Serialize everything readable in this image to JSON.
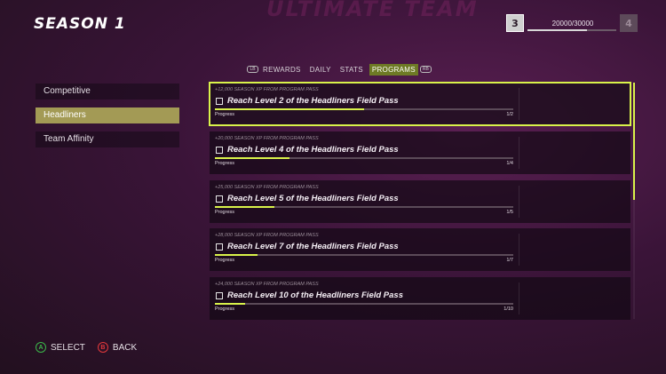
{
  "header": {
    "title": "SEASON 1",
    "watermark": "ULTIMATE TEAM",
    "level_current": "3",
    "level_next": "4",
    "xp_text": "20000/30000",
    "xp_progress": 0.6667
  },
  "tabs": {
    "lb": "LB",
    "rb": "RB",
    "items": [
      {
        "label": "REWARDS",
        "active": false
      },
      {
        "label": "DAILY",
        "active": false
      },
      {
        "label": "STATS",
        "active": false
      },
      {
        "label": "PROGRAMS",
        "active": true
      }
    ]
  },
  "sidebar": {
    "items": [
      {
        "label": "Competitive",
        "active": false
      },
      {
        "label": "Headliners",
        "active": true
      },
      {
        "label": "Team Affinity",
        "active": false
      }
    ]
  },
  "programs": [
    {
      "reward": "+12,000 SEASON XP FROM PROGRAM PASS",
      "title": "Reach Level 2 of the Headliners Field Pass",
      "progress_label": "Progress",
      "count": "1/2",
      "progress": 0.5
    },
    {
      "reward": "+20,000 SEASON XP FROM PROGRAM PASS",
      "title": "Reach Level 4 of the Headliners Field Pass",
      "progress_label": "Progress",
      "count": "1/4",
      "progress": 0.25
    },
    {
      "reward": "+25,000 SEASON XP FROM PROGRAM PASS",
      "title": "Reach Level 5 of the Headliners Field Pass",
      "progress_label": "Progress",
      "count": "1/5",
      "progress": 0.2
    },
    {
      "reward": "+28,000 SEASON XP FROM PROGRAM PASS",
      "title": "Reach Level 7 of the Headliners Field Pass",
      "progress_label": "Progress",
      "count": "1/7",
      "progress": 0.143
    },
    {
      "reward": "+24,000 SEASON XP FROM PROGRAM PASS",
      "title": "Reach Level 10 of the Headliners Field Pass",
      "progress_label": "Progress",
      "count": "1/10",
      "progress": 0.1
    }
  ],
  "footer": {
    "a_button": "A",
    "select_label": "SELECT",
    "b_button": "B",
    "back_label": "BACK"
  },
  "colors": {
    "accent": "#d9f24a",
    "active_tab": "#6e7a25",
    "active_sidebar": "#a39a55"
  }
}
